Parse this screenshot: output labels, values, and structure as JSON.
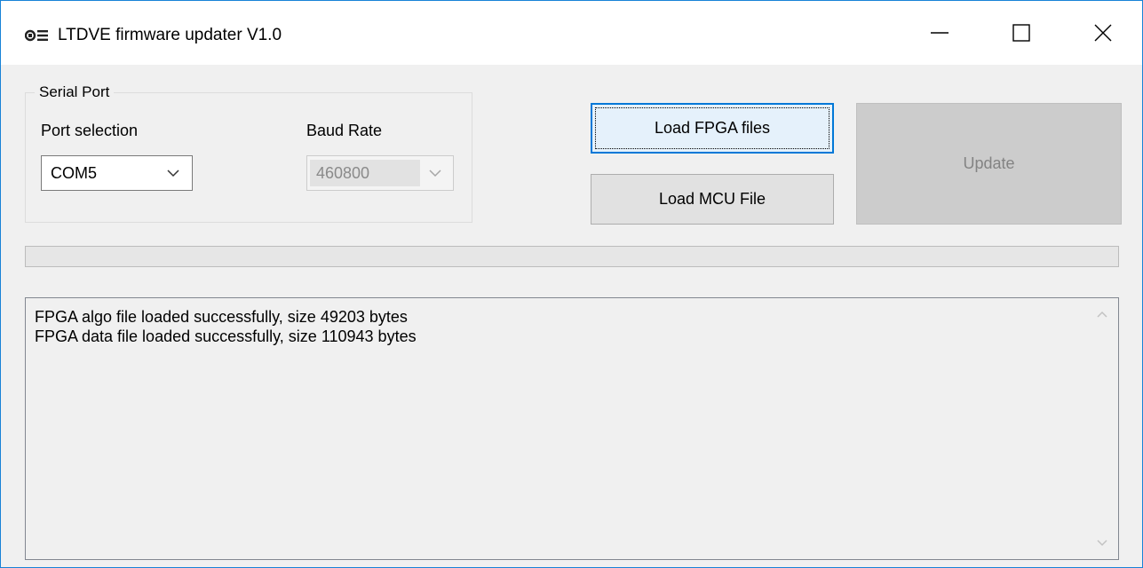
{
  "window": {
    "title": "LTDVE firmware updater V1.0",
    "app_icon": "app-icon",
    "controls": {
      "minimize": "minimize-icon",
      "maximize": "maximize-icon",
      "close": "close-icon"
    }
  },
  "serial_port": {
    "group_title": "Serial Port",
    "port_label": "Port selection",
    "port_value": "COM5",
    "baud_label": "Baud Rate",
    "baud_value": "460800",
    "baud_enabled": false
  },
  "buttons": {
    "load_fpga": "Load FPGA files",
    "load_mcu": "Load MCU File",
    "update": "Update",
    "update_enabled": false
  },
  "progress": {
    "value": 0
  },
  "log": {
    "lines": [
      "FPGA algo file loaded successfully, size 49203 bytes",
      "FPGA data file loaded successfully, size 110943 bytes"
    ]
  },
  "colors": {
    "accent": "#0078d7",
    "window_border": "#1883d7",
    "disabled_text": "#838383"
  }
}
